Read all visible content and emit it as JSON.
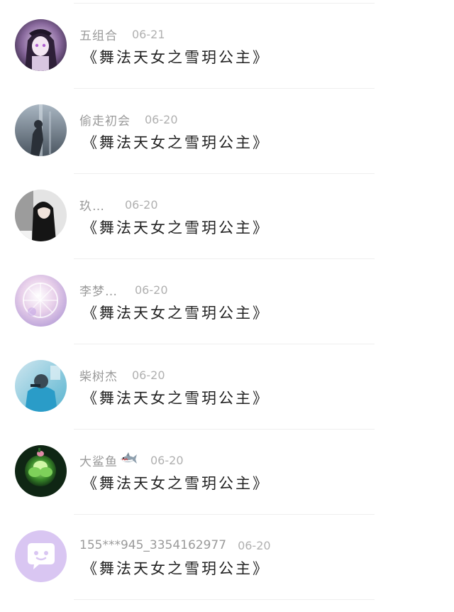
{
  "comments": [
    {
      "username": "五组合",
      "date": "06-21",
      "text": "《舞法天女之雪玥公主》",
      "avatar_icon": "anime-girl-avatar"
    },
    {
      "username": "偷走初会",
      "date": "06-20",
      "text": "《舞法天女之雪玥公主》",
      "avatar_icon": "silhouette-avatar"
    },
    {
      "username": "玖…",
      "date": "06-20",
      "text": "《舞法天女之雪玥公主》",
      "avatar_icon": "long-hair-girl-avatar"
    },
    {
      "username": "李梦…",
      "date": "06-20",
      "text": "《舞法天女之雪玥公主》",
      "avatar_icon": "pastel-circle-avatar"
    },
    {
      "username": "柴树杰",
      "date": "06-20",
      "text": "《舞法天女之雪玥公主》",
      "avatar_icon": "blue-photo-avatar"
    },
    {
      "username": "大鲨鱼",
      "username_emoji": "shark-icon",
      "date": "06-20",
      "text": "《舞法天女之雪玥公主》",
      "avatar_icon": "green-flower-avatar"
    },
    {
      "username": "155***945_3354162977",
      "date": "06-20",
      "text": "《舞法天女之雪玥公主》",
      "avatar_icon": "default-chat-avatar"
    }
  ],
  "colors": {
    "username": "#9a9a9a",
    "date": "#b0b0b0",
    "text": "#222222",
    "divider": "#eeeeee",
    "default_avatar_bg": "#d9c6f2"
  }
}
